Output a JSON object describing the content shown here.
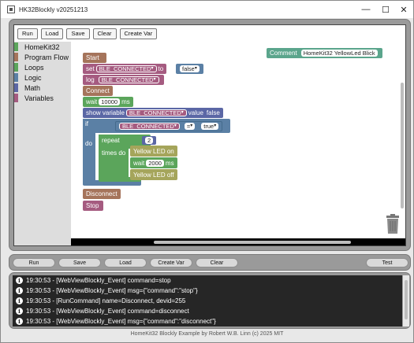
{
  "window": {
    "title": "HK32Blockly v20251213",
    "minimize": "—",
    "maximize": "☐",
    "close": "✕"
  },
  "toolbar": {
    "run": "Run",
    "load": "Load",
    "save": "Save",
    "clear": "Clear",
    "create_var": "Create Var"
  },
  "toolbox": {
    "items": [
      {
        "label": "HomeKit32",
        "color": "#5ba55b"
      },
      {
        "label": "Program Flow",
        "color": "#a5745b"
      },
      {
        "label": "Loops",
        "color": "#5ba55b"
      },
      {
        "label": "Logic",
        "color": "#5b80a5"
      },
      {
        "label": "Math",
        "color": "#5b67a5"
      },
      {
        "label": "Variables",
        "color": "#a55b80"
      }
    ]
  },
  "blocks": {
    "start": "Start",
    "set": "set",
    "ble_connected": "BLE_CONNECTED",
    "to": "to",
    "false": "false",
    "log": "log",
    "connect": "Connect",
    "wait": "wait",
    "wait_value": "10000",
    "ms": "ms",
    "show_variable": "show variable",
    "value": "value",
    "value_false": "false",
    "if": "if",
    "do": "do",
    "eq": "=",
    "true": "true",
    "repeat": "repeat",
    "repeat_count": "2",
    "times_do": "times do",
    "led_on": "Yellow LED on",
    "wait2_value": "2000",
    "led_off": "Yellow LED off",
    "disconnect": "Disconnect",
    "stop": "Stop",
    "comment_label": "Comment",
    "comment_text": "HomeKit32 YellowLed Blick"
  },
  "controls": {
    "run": "Run",
    "save": "Save",
    "load": "Load",
    "create_var": "Create Var",
    "clear": "Clear",
    "test": "Test"
  },
  "log": {
    "rows": [
      "19:30:53 - [WebViewBlockly_Event] command=stop",
      "19:30:53 - [WebViewBlockly_Event] msg={\"command\":\"stop\"}",
      "19:30:53 - [RunCommand] name=Disconnect, devid=255",
      "19:30:53 - [WebViewBlockly_Event] command=disconnect",
      "19:30:53 - [WebViewBlockly_Event] msg={\"command\":\"disconnect\"}"
    ]
  },
  "footer": "HomeKit32 Blockly Example by Robert W.B. Linn (c) 2025 MIT"
}
